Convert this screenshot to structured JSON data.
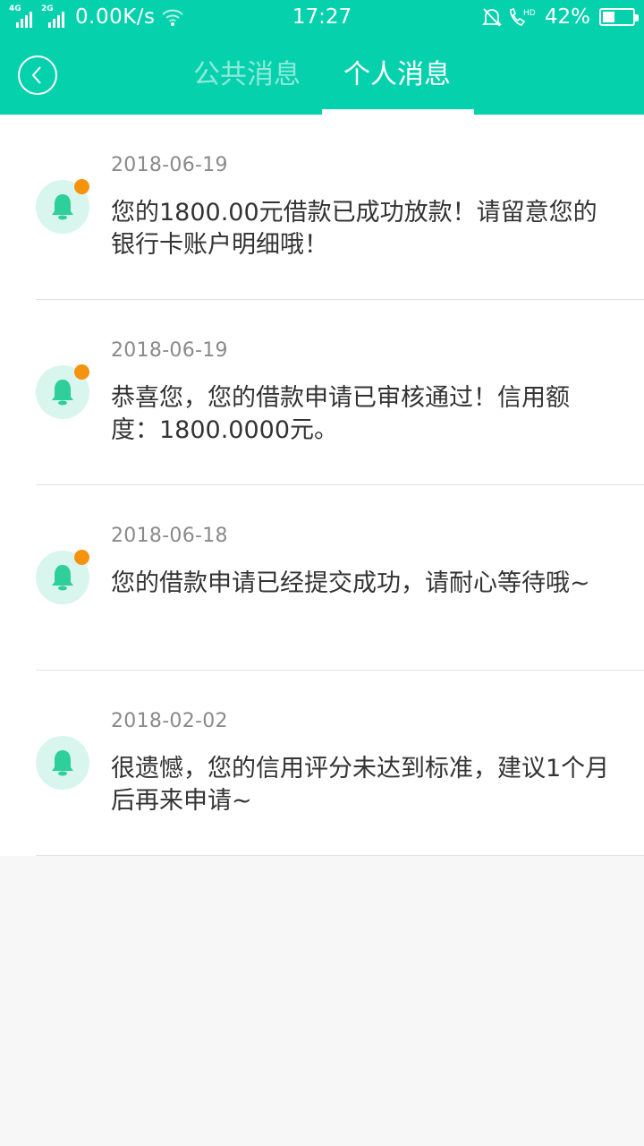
{
  "status_bar": {
    "network_1": "4G",
    "network_2": "2G",
    "speed": "0.00K/s",
    "time": "17:27",
    "battery_percent": "42%",
    "battery_level": 0.42
  },
  "colors": {
    "primary": "#06d1ad",
    "unread_dot": "#f5930f",
    "bell": "#2ecf98"
  },
  "header": {
    "tabs": [
      {
        "label": "公共消息",
        "active": false
      },
      {
        "label": "个人消息",
        "active": true
      }
    ]
  },
  "messages": [
    {
      "date": "2018-06-19",
      "text": "您的1800.00元借款已成功放款！请留意您的银行卡账户明细哦！",
      "unread": true
    },
    {
      "date": "2018-06-19",
      "text": "恭喜您，您的借款申请已审核通过！信用额度：1800.0000元。",
      "unread": true
    },
    {
      "date": "2018-06-18",
      "text": "您的借款申请已经提交成功，请耐心等待哦~",
      "unread": true
    },
    {
      "date": "2018-02-02",
      "text": "很遗憾，您的信用评分未达到标准，建议1个月后再来申请~",
      "unread": false
    }
  ]
}
